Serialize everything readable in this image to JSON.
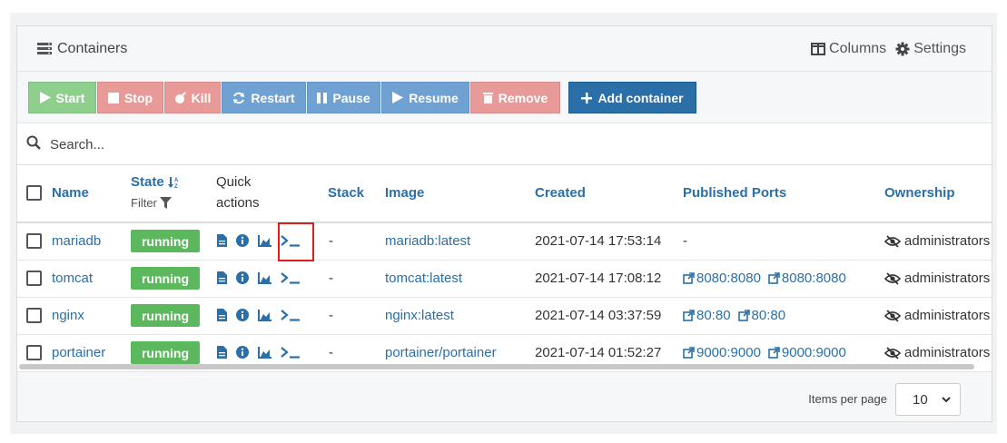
{
  "header": {
    "title": "Containers",
    "columns_label": "Columns",
    "settings_label": "Settings"
  },
  "toolbar": {
    "start": "Start",
    "stop": "Stop",
    "kill": "Kill",
    "restart": "Restart",
    "pause": "Pause",
    "resume": "Resume",
    "remove": "Remove",
    "add": "Add container"
  },
  "search": {
    "placeholder": "Search..."
  },
  "table": {
    "headers": {
      "name": "Name",
      "state": "State",
      "filter": "Filter",
      "quick_actions_1": "Quick",
      "quick_actions_2": "actions",
      "stack": "Stack",
      "image": "Image",
      "created": "Created",
      "ports": "Published Ports",
      "ownership": "Ownership"
    },
    "rows": [
      {
        "name": "mariadb",
        "state": "running",
        "stack": "-",
        "image": "mariadb:latest",
        "created": "2021-07-14 17:53:14",
        "ports": [
          "-"
        ],
        "ownership": "administrators"
      },
      {
        "name": "tomcat",
        "state": "running",
        "stack": "-",
        "image": "tomcat:latest",
        "created": "2021-07-14 17:08:12",
        "ports": [
          "8080:8080",
          "8080:8080"
        ],
        "ownership": "administrators"
      },
      {
        "name": "nginx",
        "state": "running",
        "stack": "-",
        "image": "nginx:latest",
        "created": "2021-07-14 03:37:59",
        "ports": [
          "80:80",
          "80:80"
        ],
        "ownership": "administrators"
      },
      {
        "name": "portainer",
        "state": "running",
        "stack": "-",
        "image": "portainer/portainer",
        "created": "2021-07-14 01:52:27",
        "ports": [
          "9000:9000",
          "9000:9000"
        ],
        "ownership": "administrators"
      }
    ]
  },
  "footer": {
    "items_per_page_label": "Items per page",
    "items_per_page_value": "10"
  },
  "colors": {
    "start": "#8ecf8e",
    "stop": "#e89a98",
    "restart": "#6fa1d3",
    "add": "#2a6fa8",
    "running": "#5cb85c",
    "link": "#2a6fa8",
    "highlight": "#e01b1b"
  }
}
